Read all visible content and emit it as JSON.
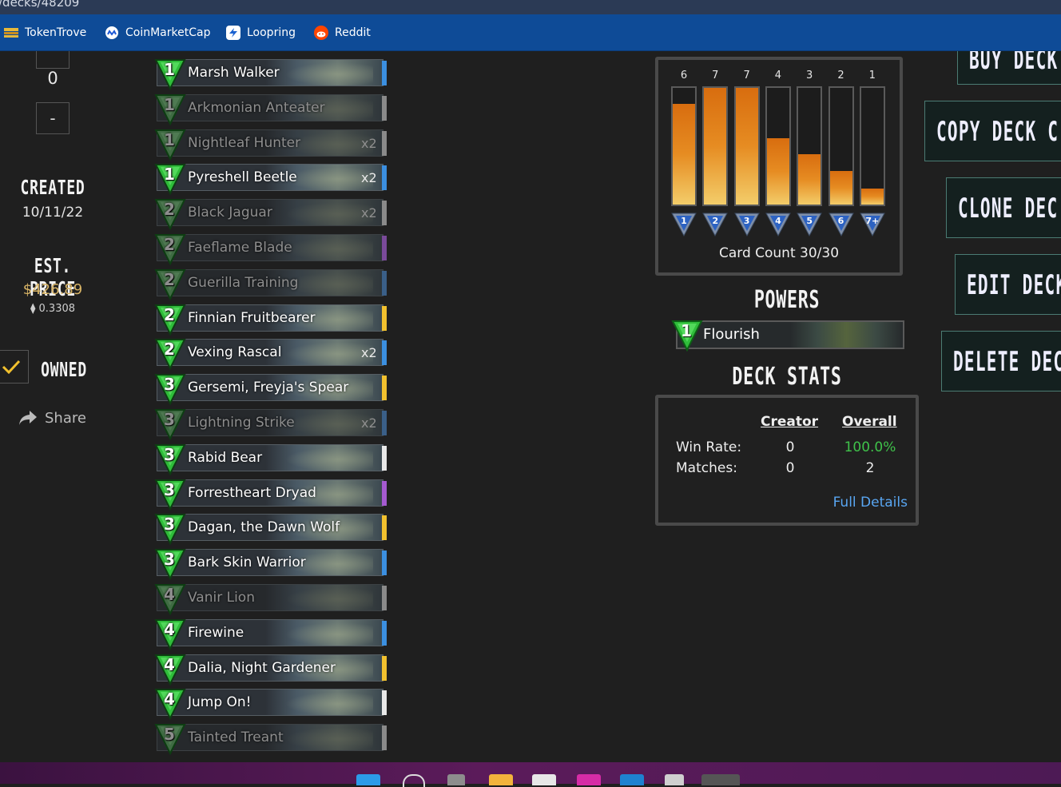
{
  "browser": {
    "url_fragment": "/decks/48209",
    "bookmarks": [
      {
        "label": "TokenTrove",
        "icon": "tokentrove-icon"
      },
      {
        "label": "CoinMarketCap",
        "icon": "coinmarketcap-icon"
      },
      {
        "label": "Loopring",
        "icon": "loopring-icon"
      },
      {
        "label": "Reddit",
        "icon": "reddit-icon"
      }
    ]
  },
  "left": {
    "quantity": "0",
    "minus_label": "-",
    "created_heading": "CREATED",
    "created_date": "10/11/22",
    "price_heading": "EST. PRICE",
    "price_usd": "$426.89",
    "price_eth": "0.3308",
    "owned_label": "OWNED",
    "share_label": "Share"
  },
  "cards": [
    {
      "cost": "1",
      "name": "Marsh Walker",
      "count": "",
      "rarity": "#3b8fe0",
      "owned": true
    },
    {
      "cost": "1",
      "name": "Arkmonian Anteater",
      "count": "",
      "rarity": "#8a8a8a",
      "owned": false
    },
    {
      "cost": "1",
      "name": "Nightleaf Hunter",
      "count": "x2",
      "rarity": "#8a8a8a",
      "owned": false
    },
    {
      "cost": "1",
      "name": "Pyreshell Beetle",
      "count": "x2",
      "rarity": "#3b8fe0",
      "owned": true
    },
    {
      "cost": "2",
      "name": "Black Jaguar",
      "count": "x2",
      "rarity": "#8a8a8a",
      "owned": false
    },
    {
      "cost": "2",
      "name": "Faeflame Blade",
      "count": "",
      "rarity": "#7a4a9a",
      "owned": false
    },
    {
      "cost": "2",
      "name": "Guerilla Training",
      "count": "",
      "rarity": "#3a5f88",
      "owned": false
    },
    {
      "cost": "2",
      "name": "Finnian Fruitbearer",
      "count": "",
      "rarity": "#f2c12e",
      "owned": true
    },
    {
      "cost": "2",
      "name": "Vexing Rascal",
      "count": "x2",
      "rarity": "#3b8fe0",
      "owned": true
    },
    {
      "cost": "3",
      "name": "Gersemi, Freyja's Spear",
      "count": "",
      "rarity": "#f2c12e",
      "owned": true
    },
    {
      "cost": "3",
      "name": "Lightning Strike",
      "count": "x2",
      "rarity": "#3a5f88",
      "owned": false
    },
    {
      "cost": "3",
      "name": "Rabid Bear",
      "count": "",
      "rarity": "#e8e8e8",
      "owned": true
    },
    {
      "cost": "3",
      "name": "Forrestheart Dryad",
      "count": "",
      "rarity": "#a55ad0",
      "owned": true
    },
    {
      "cost": "3",
      "name": "Dagan, the Dawn Wolf",
      "count": "",
      "rarity": "#f2c12e",
      "owned": true
    },
    {
      "cost": "3",
      "name": "Bark Skin Warrior",
      "count": "",
      "rarity": "#3b8fe0",
      "owned": true
    },
    {
      "cost": "4",
      "name": "Vanir Lion",
      "count": "",
      "rarity": "#8a8a8a",
      "owned": false
    },
    {
      "cost": "4",
      "name": "Firewine",
      "count": "",
      "rarity": "#3b8fe0",
      "owned": true
    },
    {
      "cost": "4",
      "name": "Dalia, Night Gardener",
      "count": "",
      "rarity": "#f2c12e",
      "owned": true
    },
    {
      "cost": "4",
      "name": "Jump On!",
      "count": "",
      "rarity": "#e8e8e8",
      "owned": true
    },
    {
      "cost": "5",
      "name": "Tainted Treant",
      "count": "",
      "rarity": "#8a8a8a",
      "owned": false
    }
  ],
  "curve": {
    "counts": [
      "6",
      "7",
      "7",
      "4",
      "3",
      "2",
      "1"
    ],
    "fill_fraction": [
      0.86,
      1.0,
      1.0,
      0.57,
      0.43,
      0.29,
      0.14
    ],
    "costs": [
      "1",
      "2",
      "3",
      "4",
      "5",
      "6",
      "7+"
    ],
    "caption": "Card Count 30/30"
  },
  "powers": {
    "heading": "POWERS",
    "items": [
      {
        "cost": "1",
        "name": "Flourish"
      }
    ]
  },
  "deck_stats": {
    "heading": "DECK STATS",
    "col_creator": "Creator",
    "col_overall": "Overall",
    "win_rate_label": "Win Rate:",
    "matches_label": "Matches:",
    "creator_win_rate": "0",
    "creator_matches": "0",
    "overall_win_rate": "100.0%",
    "overall_matches": "2",
    "full_details": "Full Details"
  },
  "actions": {
    "buy": "BUY DECK",
    "copy": "COPY DECK C",
    "clone": "CLONE DEC",
    "edit": "EDIT DECK",
    "delete": "DELETE DEC"
  },
  "colors": {
    "accent_green": "#2fbd3a",
    "win_rate_green": "#3fc24a",
    "link_blue": "#59a6f2",
    "price_gold": "#d8b466"
  }
}
